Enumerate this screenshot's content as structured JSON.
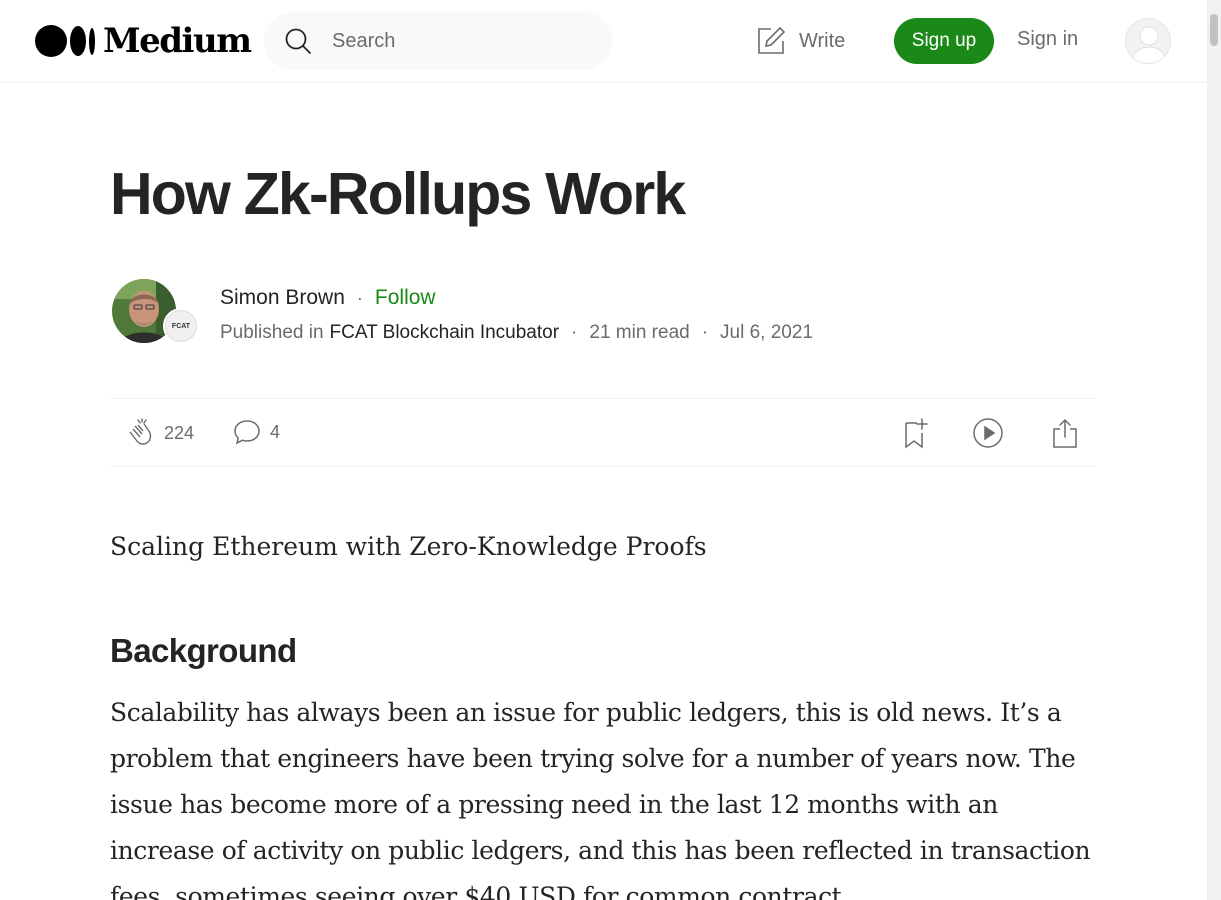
{
  "header": {
    "logo_text": "Medium",
    "search_placeholder": "Search",
    "write_label": "Write",
    "signup_label": "Sign up",
    "signin_label": "Sign in"
  },
  "article": {
    "title": "How Zk-Rollups Work",
    "author": {
      "name": "Simon Brown",
      "follow_label": "Follow"
    },
    "publication": {
      "prefix": "Published in",
      "name": "FCAT Blockchain Incubator",
      "logo_text": "FCAT"
    },
    "read_time": "21 min read",
    "date": "Jul 6, 2021",
    "claps": "224",
    "responses": "4",
    "subtitle": "Scaling Ethereum with Zero-Knowledge Proofs",
    "section_heading": "Background",
    "body": "Scalability has always been an issue for public ledgers, this is old news. It’s a problem that engineers have been trying solve for a number of years now. The issue has become more of a pressing need in the last 12 months with an increase of activity on public ledgers, and this has been reflected in transaction fees, sometimes seeing over $40 USD for common contract"
  },
  "colors": {
    "accent_green": "#1a8917",
    "text_primary": "#242424",
    "text_secondary": "#6b6b6b"
  },
  "icons": [
    "search-icon",
    "write-icon",
    "clap-icon",
    "comment-icon",
    "bookmark-add-icon",
    "play-icon",
    "share-icon",
    "user-avatar-icon"
  ]
}
